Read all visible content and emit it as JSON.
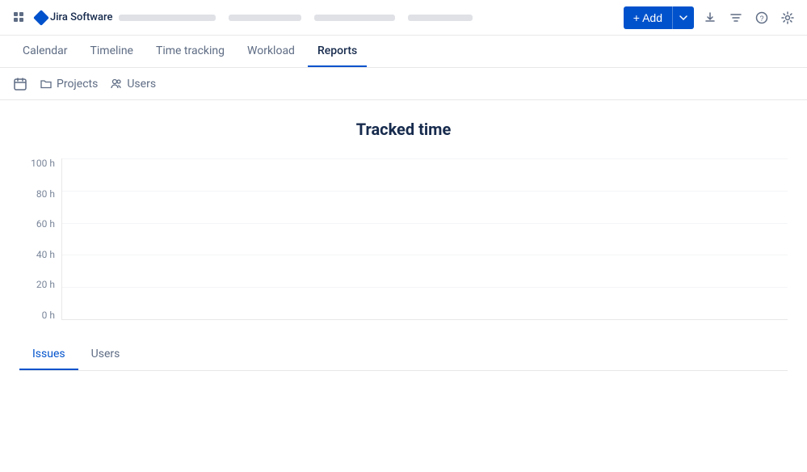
{
  "topBar": {
    "appName": "Jira Software",
    "addButtonLabel": "+ Add",
    "navPlaceholders": [
      120,
      90,
      100,
      80
    ]
  },
  "mainNav": {
    "tabs": [
      {
        "id": "calendar",
        "label": "Calendar",
        "active": false
      },
      {
        "id": "timeline",
        "label": "Timeline",
        "active": false
      },
      {
        "id": "time-tracking",
        "label": "Time tracking",
        "active": false
      },
      {
        "id": "workload",
        "label": "Workload",
        "active": false
      },
      {
        "id": "reports",
        "label": "Reports",
        "active": true
      }
    ]
  },
  "subBar": {
    "projectsLabel": "Projects",
    "usersLabel": "Users"
  },
  "chart": {
    "title": "Tracked time",
    "yAxis": [
      {
        "value": "100 h"
      },
      {
        "value": "80 h"
      },
      {
        "value": "60 h"
      },
      {
        "value": "40 h"
      },
      {
        "value": "20 h"
      },
      {
        "value": "0 h"
      }
    ]
  },
  "bottomTabs": [
    {
      "id": "issues",
      "label": "Issues",
      "active": true
    },
    {
      "id": "users",
      "label": "Users",
      "active": false
    }
  ],
  "icons": {
    "chevronDown": "▾",
    "download": "↓",
    "filter": "⧖",
    "help": "?",
    "settings": "⚙"
  }
}
